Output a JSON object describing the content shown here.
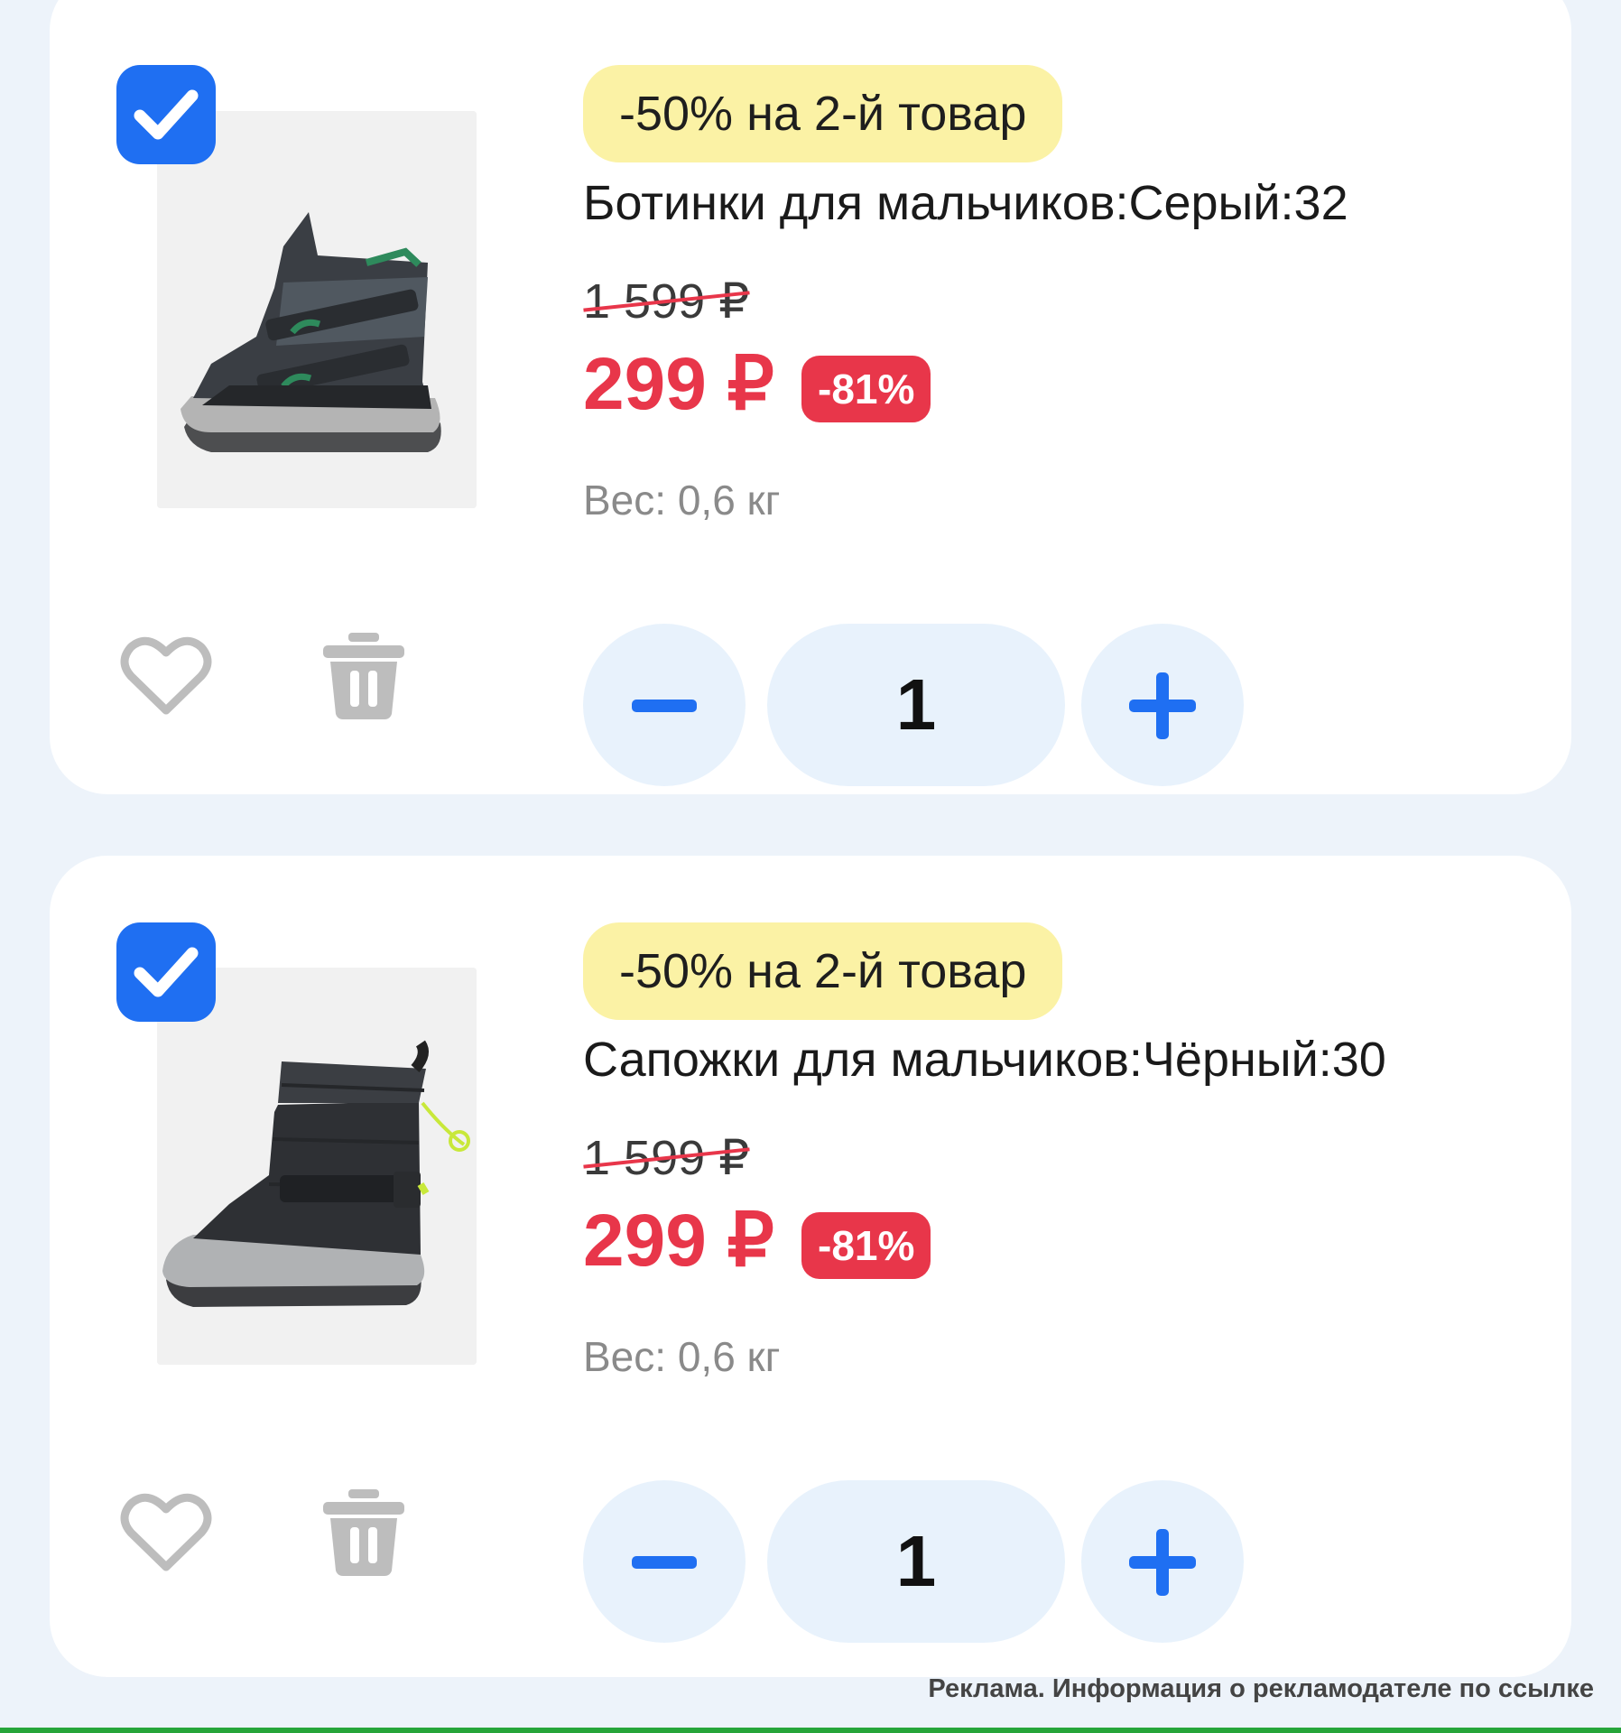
{
  "cart_items": [
    {
      "selected": true,
      "promo_badge": "-50% на 2-й товар",
      "title": "Ботинки для мальчиков:Серый:32",
      "old_price": "1 599 ₽",
      "new_price": "299 ₽",
      "discount": "-81%",
      "weight": "Вес: 0,6 кг",
      "quantity": "1",
      "icons": {
        "checkbox": "checkmark-icon",
        "favorite": "heart-icon",
        "delete": "trash-icon",
        "decrease": "minus-icon",
        "increase": "plus-icon"
      }
    },
    {
      "selected": true,
      "promo_badge": "-50% на 2-й товар",
      "title": "Сапожки для мальчиков:Чёрный:30",
      "old_price": "1 599 ₽",
      "new_price": "299 ₽",
      "discount": "-81%",
      "weight": "Вес: 0,6 кг",
      "quantity": "1",
      "icons": {
        "checkbox": "checkmark-icon",
        "favorite": "heart-icon",
        "delete": "trash-icon",
        "decrease": "minus-icon",
        "increase": "plus-icon"
      }
    }
  ],
  "ad_disclaimer": "Реклама. Информация о рекламодателе по ссылке",
  "colors": {
    "background": "#edf3fa",
    "card": "#ffffff",
    "accent_blue": "#1f6ff2",
    "promo_yellow": "#fbf2a5",
    "sale_red": "#e8364a",
    "qty_button": "#e8f2fc",
    "muted_text": "#8a8a8a"
  }
}
